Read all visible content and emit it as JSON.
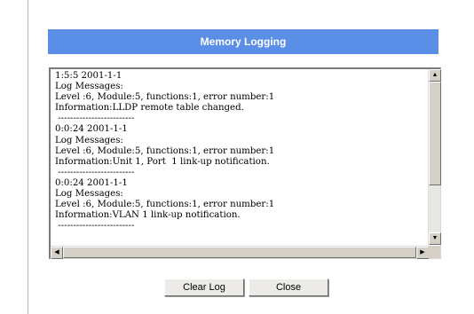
{
  "dialog": {
    "title": "Memory Logging"
  },
  "log": {
    "lines": [
      "1:5:5 2001-1-1",
      "Log Messages:",
      "Level :6, Module:5, functions:1, error number:1",
      "Information:LLDP remote table changed.",
      " -------------------------",
      "0:0:24 2001-1-1",
      "Log Messages:",
      "Level :6, Module:5, functions:1, error number:1",
      "Information:Unit 1, Port  1 link-up notification.",
      " -------------------------",
      "0:0:24 2001-1-1",
      "Log Messages:",
      "Level :6, Module:5, functions:1, error number:1",
      "Information:VLAN 1 link-up notification.",
      " -------------------------"
    ]
  },
  "buttons": {
    "clear_log": "Clear Log",
    "close": "Close"
  },
  "colors": {
    "title_bar": "#5b8ee6",
    "button_face": "#ecebe8",
    "scrollbar": "#d4d0c8"
  }
}
